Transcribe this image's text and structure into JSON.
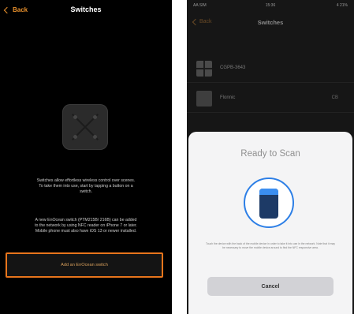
{
  "left_screen": {
    "back_label": "Back",
    "title": "Switches",
    "description": "Switches allow effortless wireless control over scenes. To take them into use, start by tapping a button on a switch.",
    "nfc_note": "A new EnOcean switch (PTM215B/ 216B) can be added to the network by using NFC reader on iPhone 7 or later. Mobile phone must also have iOS 13 or newer installed.",
    "add_button_label": "Add an EnOcean switch"
  },
  "right_screen": {
    "status": {
      "left": "AA SIM",
      "center": "15:36",
      "right": "4 21%"
    },
    "back_label": "Back",
    "title": "Switches",
    "rows": [
      {
        "label": "CGPB-3643",
        "value": ""
      },
      {
        "label": "Flonnic",
        "value": "CB"
      }
    ],
    "scan_sheet": {
      "title": "Ready to Scan",
      "instruction": "Touch the device with the back of the mobile device in order to take it into use in the network. Note that it may be necessary to move the mobile device around to find the NFC responsive area.",
      "cancel_label": "Cancel"
    }
  },
  "colors": {
    "accent_orange": "#e8902c",
    "highlight_border": "#e8751c",
    "nfc_blue": "#2d7fe6",
    "sheet_bg": "#f4f4f5"
  }
}
